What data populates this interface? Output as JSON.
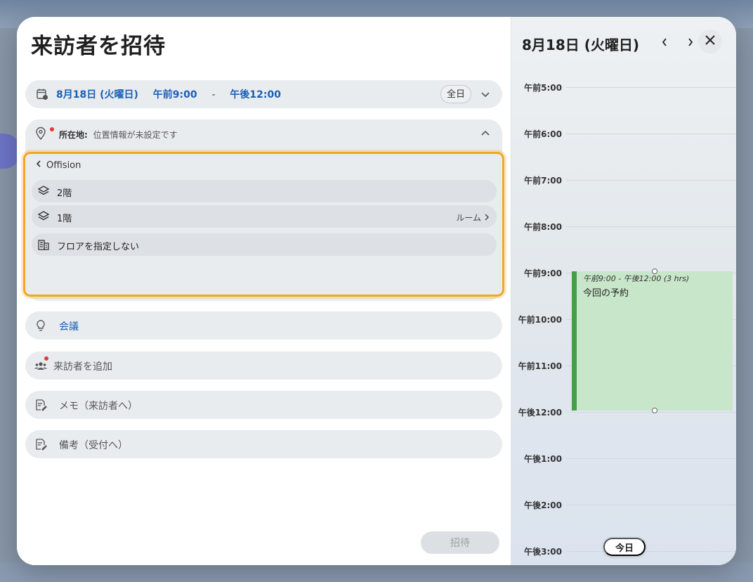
{
  "dialog": {
    "title": "来訪者を招待"
  },
  "datetime": {
    "date": "8月18日 (火曜日)",
    "start": "午前9:00",
    "separator": "-",
    "end": "午後12:00",
    "all_day_label": "全日"
  },
  "location": {
    "label": "所在地:",
    "value": "位置情報が未設定です",
    "back_label": "Offision",
    "floors": [
      {
        "label": "2階",
        "room_link": ""
      },
      {
        "label": "1階",
        "room_link": "ルーム"
      },
      {
        "label": "フロアを指定しない",
        "room_link": ""
      }
    ]
  },
  "fields": {
    "purpose": "会議",
    "add_visitor": "来訪者を追加",
    "memo_visitor": "メモ（来訪者へ）",
    "memo_reception": "備考（受付へ）"
  },
  "invite_button": "招待",
  "calendar": {
    "date_title": "8月18日 (火曜日)",
    "hours": [
      "午前5:00",
      "午前6:00",
      "午前7:00",
      "午前8:00",
      "午前9:00",
      "午前10:00",
      "午前11:00",
      "午後12:00",
      "午後1:00",
      "午後2:00",
      "午後3:00"
    ],
    "event": {
      "time": "午前9:00 - 午後12:00 (3 hrs)",
      "title": "今回の予約",
      "color": "#43a047"
    },
    "today_button": "今日"
  },
  "colors": {
    "accent_blue": "#1a5fb4",
    "focus_orange": "#f5a623",
    "alert_red": "#e53935"
  }
}
